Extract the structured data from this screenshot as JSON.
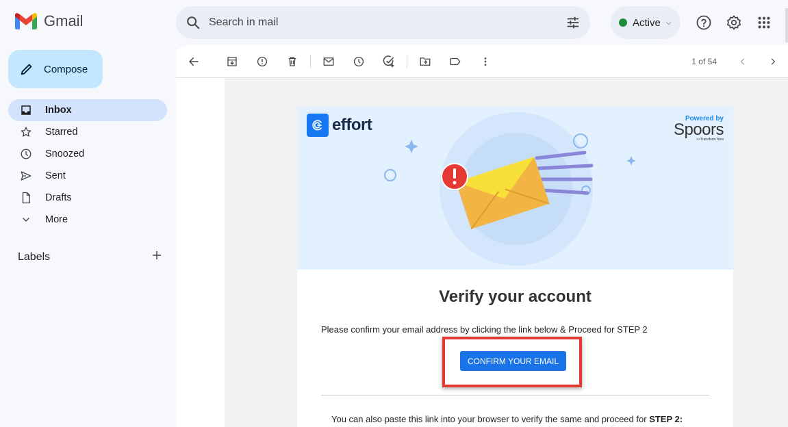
{
  "app": {
    "name": "Gmail"
  },
  "search": {
    "placeholder": "Search in mail"
  },
  "status": {
    "label": "Active",
    "color": "#1e8e3e"
  },
  "sidebar": {
    "compose_label": "Compose",
    "items": [
      {
        "label": "Inbox",
        "icon": "inbox-icon",
        "active": true
      },
      {
        "label": "Starred",
        "icon": "star-icon"
      },
      {
        "label": "Snoozed",
        "icon": "clock-icon"
      },
      {
        "label": "Sent",
        "icon": "send-icon"
      },
      {
        "label": "Drafts",
        "icon": "draft-icon"
      },
      {
        "label": "More",
        "icon": "chevron-down-icon"
      }
    ],
    "labels_title": "Labels"
  },
  "toolbar": {
    "pager": "1 of 54"
  },
  "email": {
    "brand": "effort",
    "powered_by": "Powered by",
    "partner": "Spoors",
    "tagline": ">>Transform Now",
    "title": "Verify your account",
    "message": "Please confirm your email address by clicking the link below & Proceed for STEP 2",
    "button_label": "CONFIRM YOUR EMAIL",
    "paste_message": "You can also paste this link into your browser to verify the same and proceed for",
    "paste_step": "STEP 2:"
  },
  "colors": {
    "accent": "#1a73e8",
    "highlight": "#e53935",
    "compose_bg": "#c2e7ff",
    "active_nav": "#d3e3fd"
  }
}
